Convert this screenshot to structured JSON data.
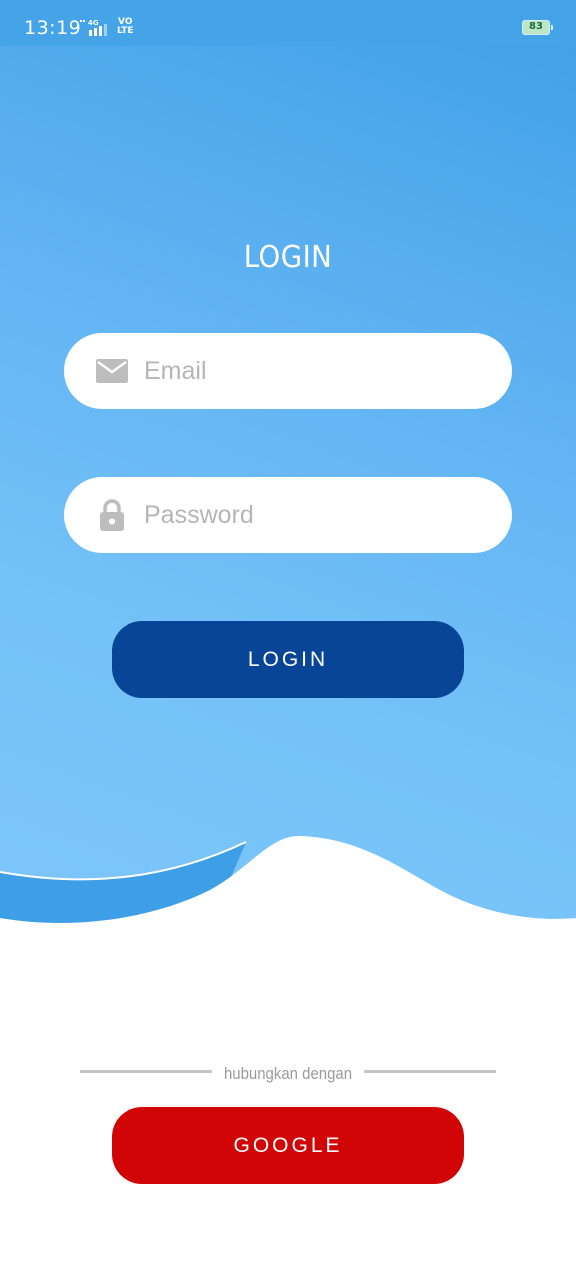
{
  "status_bar": {
    "time": "13:19",
    "network": "4G",
    "volte_top": "VO",
    "volte_bottom": "LTE",
    "battery": "83"
  },
  "login_form": {
    "title": "LOGIN",
    "email_placeholder": "Email",
    "password_placeholder": "Password",
    "submit_label": "LOGIN"
  },
  "social": {
    "divider_text": "hubungkan dengan",
    "google_label": "GOOGLE"
  },
  "colors": {
    "background_top": "#3f9fe6",
    "background_bottom": "#7dc6fa",
    "login_button": "#084596",
    "google_button": "#d10505",
    "field_background": "#ffffff",
    "placeholder": "#b5b5b5"
  },
  "icons": {
    "email": "envelope-icon",
    "password": "lock-icon"
  }
}
